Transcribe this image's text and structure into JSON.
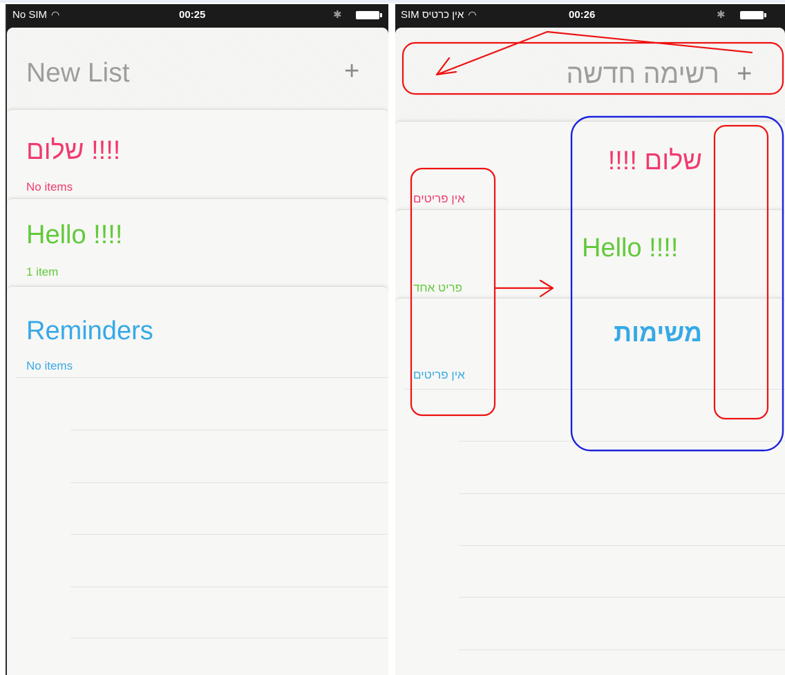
{
  "left_phone": {
    "status": {
      "carrier": "No SIM",
      "time": "00:25"
    },
    "header": {
      "title": "New List",
      "add_label": "+"
    },
    "lists": [
      {
        "title": "שלום !!!!",
        "subtitle": "No items",
        "color": "#f03a6d"
      },
      {
        "title": "Hello !!!!",
        "subtitle": "1 item",
        "color": "#63c93a"
      },
      {
        "title": "Reminders",
        "subtitle": "No items",
        "color": "#36a9e6"
      }
    ]
  },
  "right_phone": {
    "status": {
      "carrier": "SIM אין כרטיס",
      "time": "00:26"
    },
    "header": {
      "title": "רשימה חדשה",
      "add_label": "+"
    },
    "lists": [
      {
        "title": "שלום !!!!",
        "subtitle": "אין פריטים",
        "color": "#f03a6d"
      },
      {
        "title": "Hello !!!!",
        "subtitle": "פריט אחד",
        "color": "#63c93a"
      },
      {
        "title": "משימות",
        "subtitle": "אין פריטים",
        "color": "#36a9e6"
      }
    ]
  },
  "annotation_colors": {
    "red": "#ee1111",
    "blue": "#1a22dd"
  },
  "icons": {
    "wifi": "wifi-icon",
    "bluetooth": "bluetooth-icon",
    "battery": "battery-icon"
  }
}
